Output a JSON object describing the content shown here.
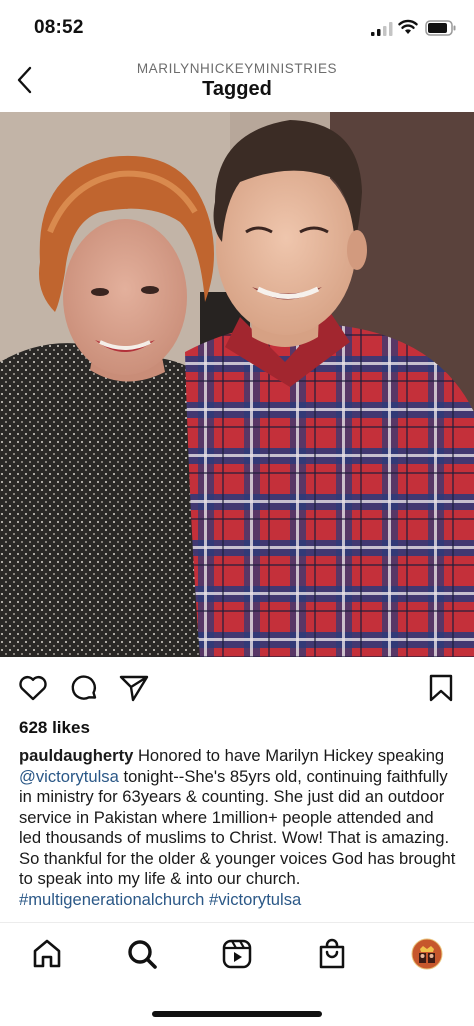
{
  "status_bar": {
    "time": "08:52",
    "icons": [
      "cellular-signal-icon",
      "wifi-icon",
      "battery-icon"
    ]
  },
  "header": {
    "back_icon": "chevron-left-icon",
    "account": "MARILYNHICKEYMINISTRIES",
    "title": "Tagged"
  },
  "post": {
    "image_description_icon": "photo",
    "actions": [
      "heart-icon",
      "comment-icon",
      "share-icon",
      "bookmark-icon"
    ],
    "likes": "628 likes",
    "caption": {
      "username": "pauldaugherty",
      "text_1": " Honored to have Marilyn Hickey speaking ",
      "mention": "@victorytulsa",
      "text_2": " tonight--She's 85yrs old, continuing faithfully in ministry for 63years & counting. She just did an outdoor service in Pakistan where 1million+ people attended and led thousands of muslims to Christ. Wow! That is amazing. So thankful for the older & younger voices God has brought to speak into my life & into our church.",
      "hashtags": "#multigenerationalchurch #victorytulsa"
    }
  },
  "bottom_nav": {
    "items": [
      "home-icon",
      "search-icon",
      "reels-icon",
      "shop-icon",
      "profile-avatar"
    ]
  },
  "colors": {
    "link": "#2b5887",
    "text": "#111111",
    "muted": "#6d6d6d",
    "background": "#ffffff"
  }
}
